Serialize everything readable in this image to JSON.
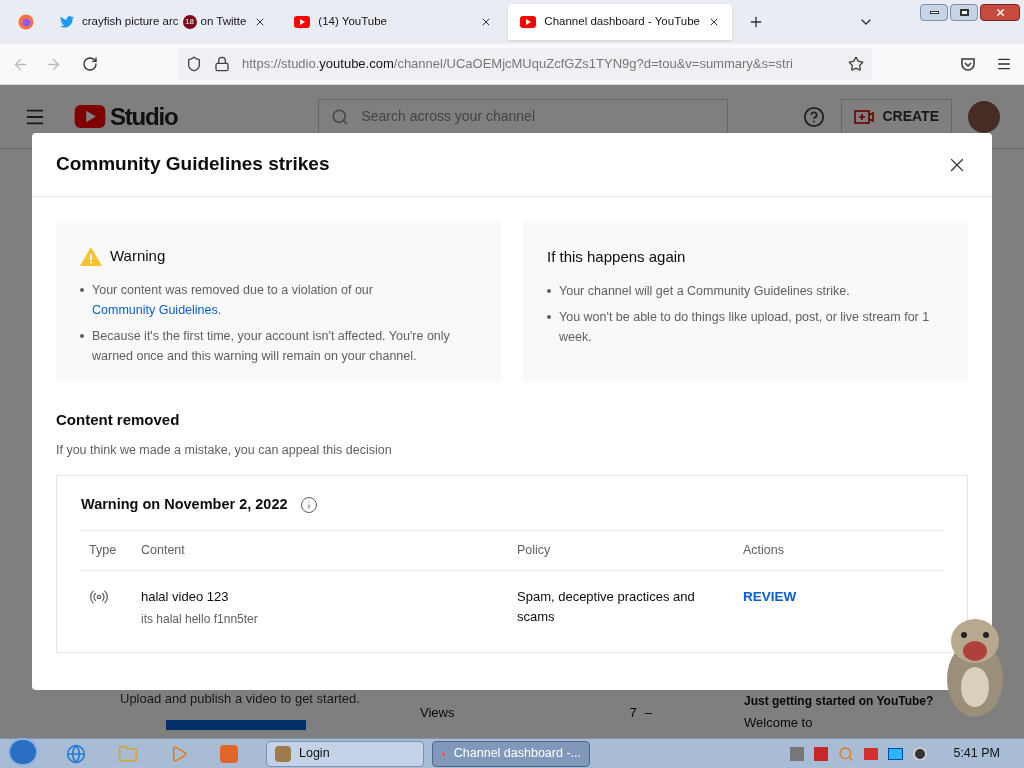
{
  "browser": {
    "tabs": [
      {
        "kind": "twitter",
        "title": "crayfish picture arc",
        "badge": "18",
        "title_end": "on Twitte",
        "selected": false
      },
      {
        "kind": "youtube",
        "title": "(14) YouTube",
        "selected": false
      },
      {
        "kind": "youtube",
        "title": "Channel dashboard - YouTube",
        "selected": true
      }
    ],
    "url": {
      "prefix": "https://studio.",
      "host": "youtube.com",
      "rest": "/channel/UCaOEMjcMUquZcfGZs1TYN9g?d=tou&v=summary&s=stri"
    }
  },
  "studio": {
    "logo_text": "Studio",
    "search": {
      "placeholder": "Search across your channel"
    },
    "create_button": "CREATE",
    "behind": {
      "upload_hint": "Upload and publish a video to get started.",
      "views_label": "Views",
      "views_value": "7",
      "views_change": "–",
      "tip_title": "Just getting started on YouTube?",
      "tip_text": "Welcome to"
    }
  },
  "dialog": {
    "title": "Community Guidelines strikes",
    "warning_card": {
      "title": "Warning",
      "bullets": [
        {
          "text": "Your content was removed due to a violation of our ",
          "link": "Community Guidelines",
          "after": "."
        },
        {
          "text": "Because it's the first time, your account isn't affected. You're only warned once and this warning will remain on your channel."
        }
      ]
    },
    "again_card": {
      "title": "If this happens again",
      "bullets": [
        {
          "text": "Your channel will get a Community Guidelines strike."
        },
        {
          "text": "You won't be able to do things like upload, post, or live stream for 1 week."
        }
      ]
    },
    "content_removed": {
      "title": "Content removed",
      "subtitle": "If you think we made a mistake, you can appeal this decision"
    },
    "strike": {
      "title": "Warning on November 2, 2022",
      "columns": [
        "Type",
        "Content",
        "Policy",
        "Actions"
      ],
      "rows": [
        {
          "kind": "live",
          "content_title": "halal video 123",
          "content_subtitle": "its halal hello f1nn5ter",
          "policy": "Spam, deceptive practices and scams",
          "action": "REVIEW"
        }
      ]
    }
  },
  "taskbar": {
    "tasks": [
      {
        "kind": "app",
        "label": "Login",
        "selected": false
      },
      {
        "kind": "firefox",
        "label": "Channel dashboard -...",
        "selected": true
      }
    ],
    "clock": "5:41 PM"
  }
}
